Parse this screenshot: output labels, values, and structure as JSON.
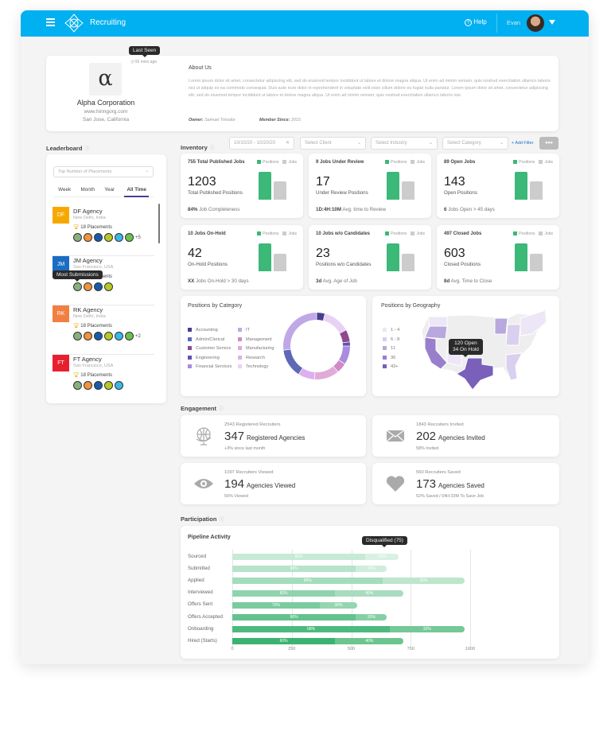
{
  "header": {
    "app_title": "Recruiting",
    "help": "Help",
    "user": "Evan",
    "brand_color": "#00b0f0"
  },
  "profile": {
    "logo_glyph": "α",
    "company": "Alpha Corporation",
    "website": "www.hiringorg.com",
    "location": "San Jose, California",
    "last_seen_tooltip": "Last Seen",
    "last_seen": "56 mins ago",
    "about_title": "About Us",
    "about_text": "Lorem ipsum dolor sit amet, consectetur adipiscing elit, sed do eiusmod tempor incididunt ut labore et dolore magna aliqua. Ut enim ad minim veniam, quis nostrud exercitation ullamco laboris nisi ut aliquip ex ea commodo consequat. Duis aute irure dolor in reprehenderit in voluptate velit esse cillum dolore eu fugiat nulla pariatur. Lorem ipsum dolor sit amet, consectetur adipiscing elit, sed do eiusmod tempor incididunt ut labore et dolore magna aliqua. Ut enim ad minim veniam, quis nostrud exercitation ullamco laboris nisi.",
    "owner_label": "Owner:",
    "owner": "Samuel Trissdor",
    "member_label": "Member Since:",
    "member_since": "2015"
  },
  "leaderboard": {
    "title": "Leaderboard",
    "select_placeholder": "Top Number of Placements",
    "tabs": [
      "Week",
      "Month",
      "Year",
      "All Time"
    ],
    "active_tab": "All Time",
    "tooltip": "Most Submissions",
    "items": [
      {
        "initials": "DF",
        "name": "DF Agency",
        "location": "New Delhi, India",
        "placements": "18 Placements",
        "color": "#f7a800",
        "badges": 6,
        "more": "+5"
      },
      {
        "initials": "JM",
        "name": "JM Agency",
        "location": "San Francisco, USA",
        "placements": "18 Placements",
        "color": "#1a6dc2",
        "badges": 4,
        "more": ""
      },
      {
        "initials": "RK",
        "name": "RK Agency",
        "location": "New Delhi, India",
        "placements": "18 Placements",
        "color": "#f27f42",
        "badges": 6,
        "more": "+2"
      },
      {
        "initials": "FT",
        "name": "FT Agency",
        "location": "San Francisco, USA",
        "placements": "18 Placements",
        "color": "#e8202e",
        "badges": 5,
        "more": ""
      }
    ]
  },
  "inventory": {
    "title": "Inventory",
    "date_range": "10/10/20 - 10/20/20",
    "client_placeholder": "Select Client",
    "industry_placeholder": "Select Industry",
    "category_placeholder": "Select Category",
    "add_filter": "+ Add Filter",
    "legend_positions": "Positions",
    "legend_jobs": "Jobs",
    "positions_color": "#3cb878",
    "jobs_color": "#cccccc",
    "cards": [
      {
        "title": "755 Total Published Jobs",
        "value": "1203",
        "subtitle": "Total Published Positions",
        "foot_bold": "84%",
        "foot": "Job Completeness",
        "positions_level": 100,
        "jobs_level": 66
      },
      {
        "title": "9 Jobs Under Review",
        "value": "17",
        "subtitle": "Under Review Positions",
        "foot_bold": "1D:4H:10M",
        "foot": "Avg. time to Review",
        "positions_level": 100,
        "jobs_level": 66
      },
      {
        "title": "89 Open Jobs",
        "value": "143",
        "subtitle": "Open Positions",
        "foot_bold": "6",
        "foot": "Jobs Open > 45 days",
        "positions_level": 100,
        "jobs_level": 66
      },
      {
        "title": "10 Jobs On-Hold",
        "value": "42",
        "subtitle": "On-Hold Positions",
        "foot_bold": "XX",
        "foot": "Jobs On-Hold > 30 days",
        "positions_level": 100,
        "jobs_level": 64
      },
      {
        "title": "10 Jobs w/o Candidates",
        "value": "23",
        "subtitle": "Positions w/o Candidates",
        "foot_bold": "3d",
        "foot": "Avg. Age of Job",
        "positions_level": 100,
        "jobs_level": 64
      },
      {
        "title": "497 Closed Jobs",
        "value": "603",
        "subtitle": "Closed Positions",
        "foot_bold": "8d",
        "foot": "Avg. Time to Close",
        "positions_level": 100,
        "jobs_level": 64
      }
    ]
  },
  "category": {
    "title": "Positions by Category",
    "legend": [
      {
        "label": "Accounting",
        "color": "#4a3d8f",
        "value": 4
      },
      {
        "label": "Admin/Clerical",
        "color": "#5d69b5",
        "value": 14
      },
      {
        "label": "Customer Service",
        "color": "#8e4a8f",
        "value": 6
      },
      {
        "label": "Engineering",
        "color": "#6550b0",
        "value": 2
      },
      {
        "label": "Financial Services",
        "color": "#a98be0",
        "value": 9
      },
      {
        "label": "IT",
        "color": "#c0a8e6",
        "value": 27
      },
      {
        "label": "Management",
        "color": "#d08ac8",
        "value": 5
      },
      {
        "label": "Manufacturing",
        "color": "#e0abd8",
        "value": 12
      },
      {
        "label": "Research",
        "color": "#dcb0ee",
        "value": 8
      },
      {
        "label": "Technology",
        "color": "#e8d2f4",
        "value": 13
      }
    ],
    "ring_order": [
      "Accounting",
      "Technology",
      "Customer Service",
      "Engineering",
      "Financial Services",
      "Management",
      "Manufacturing",
      "Research",
      "Admin/Clerical",
      "IT"
    ]
  },
  "geography": {
    "title": "Positions by Geography",
    "legend": [
      {
        "label": "1 - 4",
        "color": "#ece6f7"
      },
      {
        "label": "6 - 8",
        "color": "#d9cfee"
      },
      {
        "label": "11",
        "color": "#b9a8de"
      },
      {
        "label": "36",
        "color": "#977fcc"
      },
      {
        "label": "43+",
        "color": "#7a5fbb"
      }
    ],
    "tooltip_line1": "120 Open",
    "tooltip_line2": "34 On Hold"
  },
  "engagement": {
    "title": "Engagement",
    "cards": [
      {
        "icon": "globe-icon",
        "top": "2543 Registered Recruiters",
        "value": "347",
        "label": "Registered Agencies",
        "foot": "+3% since last month"
      },
      {
        "icon": "envelope-icon",
        "top": "1843 Recruiters Invited",
        "value": "202",
        "label": "Agencies Invited",
        "foot": "58% Invited"
      },
      {
        "icon": "eye-icon",
        "top": "1097 Recruiters Viewed",
        "value": "194",
        "label": "Agencies Viewed",
        "foot": "56% Viewed"
      },
      {
        "icon": "heart-icon",
        "top": "560 Recruiters Saved",
        "value": "173",
        "label": "Agencies Saved",
        "foot": "52% Saved / 04H:33M To Save Job"
      }
    ]
  },
  "participation": {
    "title": "Participation",
    "chart_data": {
      "type": "bar",
      "orientation": "horizontal",
      "stacked": true,
      "title": "Pipeline Activity",
      "xlim": [
        0,
        1000
      ],
      "ticks": [
        "0",
        "250",
        "500",
        "750",
        "1000"
      ],
      "grid": true,
      "tooltip": "Disqualified (75)",
      "categories": [
        "Sourced",
        "Submitted",
        "Applied",
        "Interviewed",
        "Offers Sent",
        "Offers Accepted",
        "Onboarding",
        "Hired (Starts)"
      ],
      "totals": [
        700,
        650,
        975,
        720,
        525,
        650,
        975,
        720
      ],
      "split_pct": [
        [
          80,
          20
        ],
        [
          80,
          20
        ],
        [
          65,
          35
        ],
        [
          60,
          40
        ],
        [
          70,
          30
        ],
        [
          80,
          20
        ],
        [
          68,
          32
        ],
        [
          60,
          40
        ]
      ],
      "colors": [
        [
          "#c7ead6",
          "#d9f1e3"
        ],
        [
          "#b6e3c9",
          "#cdeedb"
        ],
        [
          "#a4dcbc",
          "#bde6cd"
        ],
        [
          "#8fd3ad",
          "#a8dcbe"
        ],
        [
          "#7acb9e",
          "#95d5b0"
        ],
        [
          "#63c28d",
          "#85cfa4"
        ],
        [
          "#4cba7d",
          "#75c897"
        ],
        [
          "#3ab370",
          "#6cc58f"
        ]
      ]
    }
  }
}
